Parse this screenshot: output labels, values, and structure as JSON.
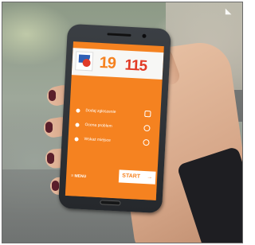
{
  "screen": {
    "brand_19": "19",
    "brand_115": "115",
    "options": [
      {
        "label": "Dodaj zgłoszenie",
        "icon": "camera-icon"
      },
      {
        "label": "Ocena problem",
        "icon": "hand-icon"
      },
      {
        "label": "Wskaż miejsce",
        "icon": "location-icon"
      }
    ],
    "menu_label": "≡ MENU",
    "start_label": "START",
    "start_arrow": "→"
  },
  "colors": {
    "accent": "#f58220",
    "brand_red": "#e23a25"
  }
}
